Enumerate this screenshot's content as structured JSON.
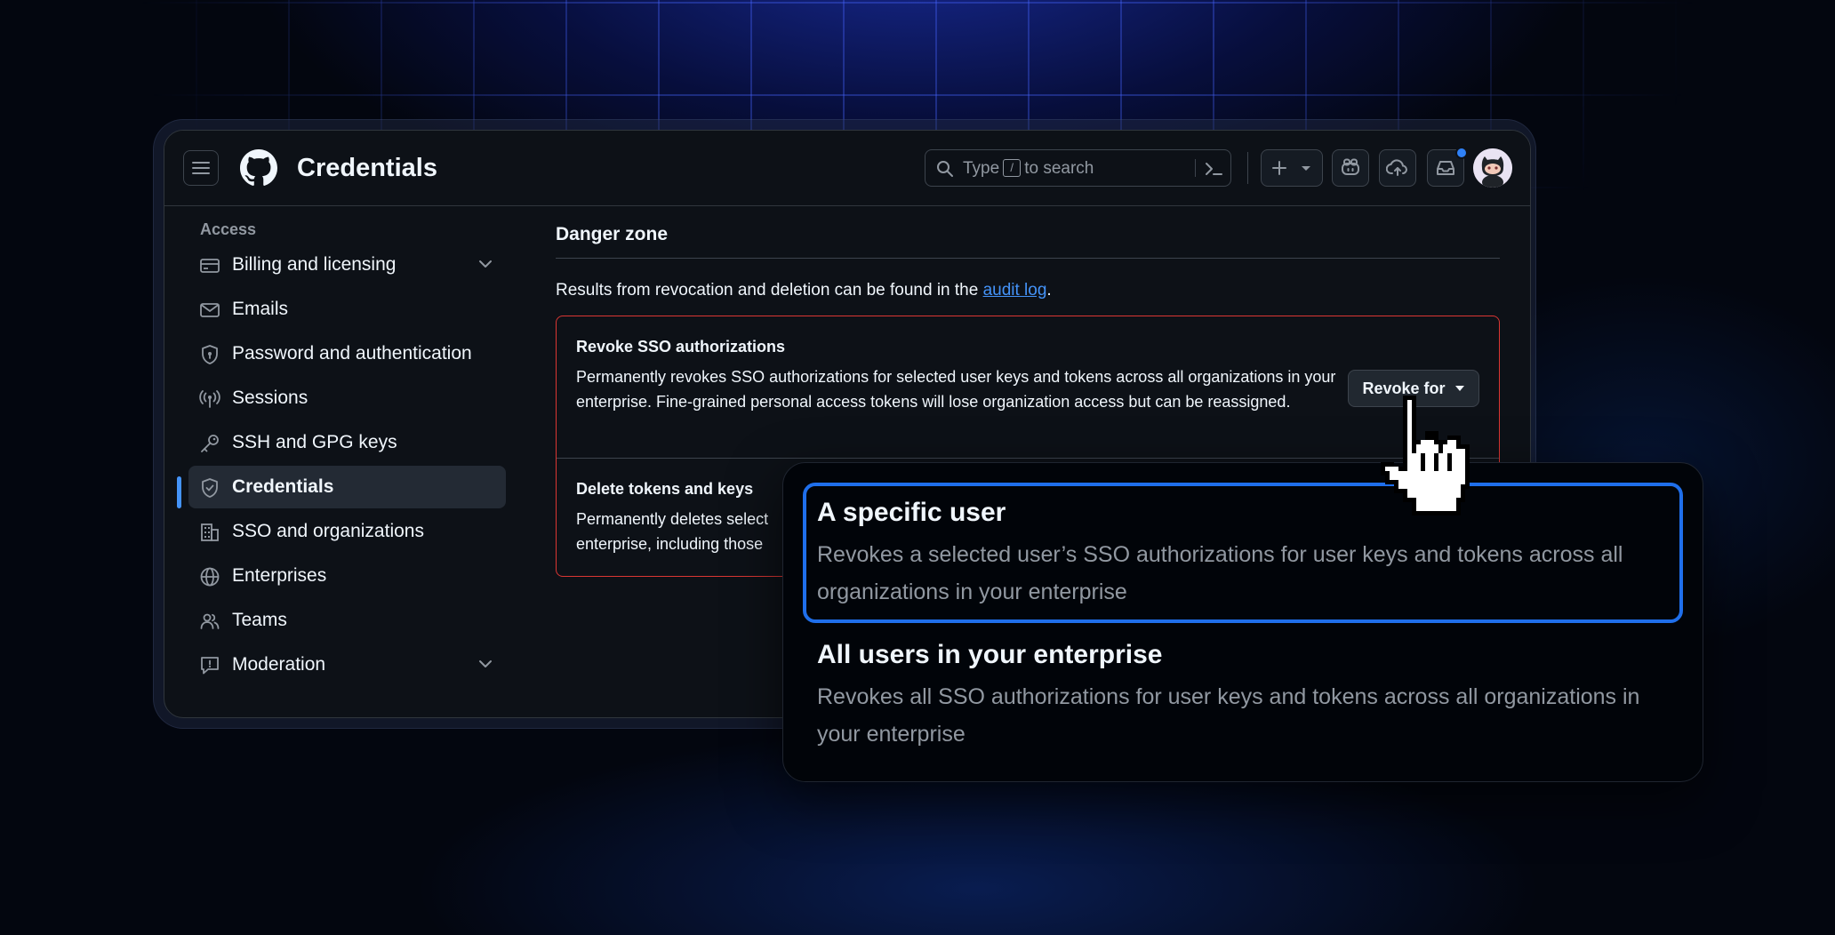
{
  "header": {
    "title": "Credentials",
    "search_prefix": "Type",
    "search_key": "/",
    "search_suffix": "to search"
  },
  "sidebar": {
    "heading": "Access",
    "items": [
      {
        "label": "Billing and licensing",
        "icon": "credit-card-icon",
        "expandable": true
      },
      {
        "label": "Emails",
        "icon": "mail-icon"
      },
      {
        "label": "Password and authentication",
        "icon": "shield-lock-icon"
      },
      {
        "label": "Sessions",
        "icon": "broadcast-icon"
      },
      {
        "label": "SSH and GPG keys",
        "icon": "key-icon"
      },
      {
        "label": "Credentials",
        "icon": "shield-check-icon",
        "active": true
      },
      {
        "label": "SSO and organizations",
        "icon": "organization-icon"
      },
      {
        "label": "Enterprises",
        "icon": "globe-icon"
      },
      {
        "label": "Teams",
        "icon": "people-icon"
      },
      {
        "label": "Moderation",
        "icon": "report-icon",
        "expandable": true
      }
    ]
  },
  "main": {
    "section_title": "Danger zone",
    "description_prefix": "Results from revocation and deletion can be found in the",
    "description_link": "audit log",
    "description_suffix": ".",
    "revoke": {
      "title": "Revoke SSO authorizations",
      "description": "Permanently revokes SSO authorizations for selected user keys and tokens across all organizations in your enterprise. Fine-grained personal access tokens will lose organization access but can be reassigned.",
      "button_label": "Revoke for"
    },
    "delete": {
      "title": "Delete tokens and keys",
      "description_line1": "Permanently deletes select",
      "description_line2": "enterprise, including those"
    }
  },
  "dropdown": {
    "options": [
      {
        "title": "A specific user",
        "description": "Revokes a selected user’s SSO authorizations for user keys and tokens across all organizations in your enterprise",
        "selected": true
      },
      {
        "title": "All users in your enterprise",
        "description": "Revokes all SSO authorizations for user keys and tokens across all organizations in your enterprise",
        "selected": false
      }
    ]
  },
  "colors": {
    "accent": "#1f6feb",
    "link": "#4493f8",
    "danger_border": "#da3633",
    "background": "#0d1117"
  }
}
